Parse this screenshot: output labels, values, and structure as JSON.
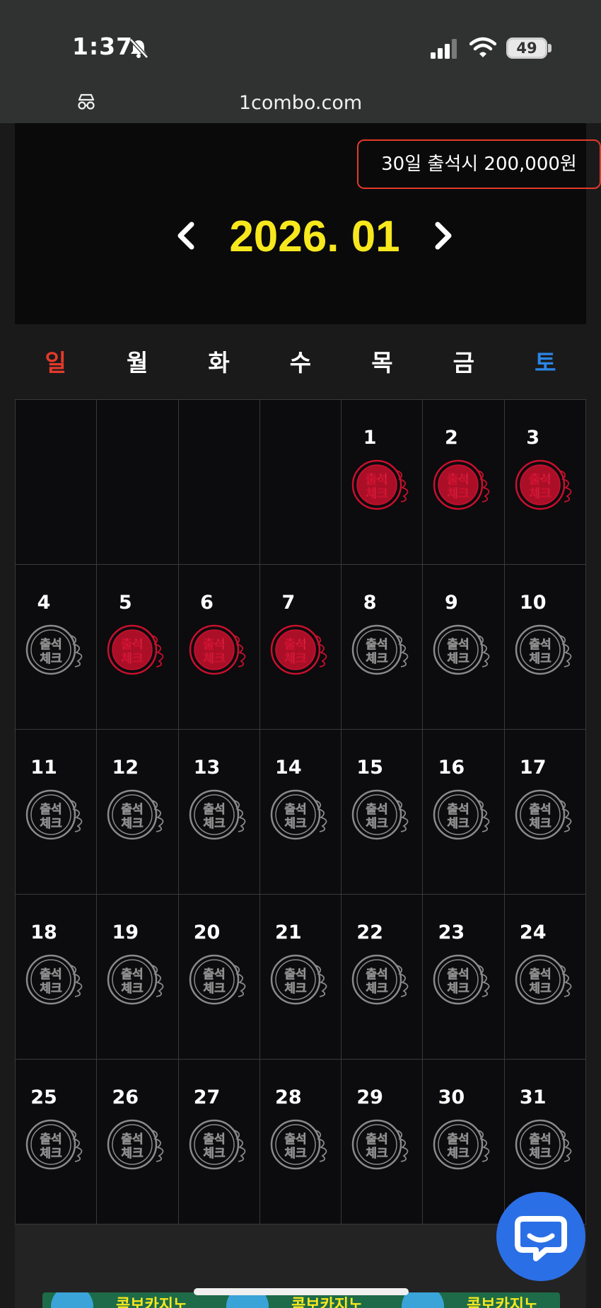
{
  "status_bar": {
    "time": "1:37",
    "battery": "49"
  },
  "browser": {
    "url": "1combo.com"
  },
  "attendance": {
    "reward_text": "30일 출석시 200,000원",
    "month_title": "2026. 01",
    "weekdays": [
      "일",
      "월",
      "화",
      "수",
      "목",
      "금",
      "토"
    ],
    "stamp_text": [
      "출석",
      "체크"
    ],
    "leading_blank_days": 4,
    "days": [
      {
        "day": "1",
        "checked": true
      },
      {
        "day": "2",
        "checked": true
      },
      {
        "day": "3",
        "checked": true
      },
      {
        "day": "4",
        "checked": false
      },
      {
        "day": "5",
        "checked": true
      },
      {
        "day": "6",
        "checked": true
      },
      {
        "day": "7",
        "checked": true
      },
      {
        "day": "8",
        "checked": false
      },
      {
        "day": "9",
        "checked": false
      },
      {
        "day": "10",
        "checked": false
      },
      {
        "day": "11",
        "checked": false
      },
      {
        "day": "12",
        "checked": false
      },
      {
        "day": "13",
        "checked": false
      },
      {
        "day": "14",
        "checked": false
      },
      {
        "day": "15",
        "checked": false
      },
      {
        "day": "16",
        "checked": false
      },
      {
        "day": "17",
        "checked": false
      },
      {
        "day": "18",
        "checked": false
      },
      {
        "day": "19",
        "checked": false
      },
      {
        "day": "20",
        "checked": false
      },
      {
        "day": "21",
        "checked": false
      },
      {
        "day": "22",
        "checked": false
      },
      {
        "day": "23",
        "checked": false
      },
      {
        "day": "24",
        "checked": false
      },
      {
        "day": "25",
        "checked": false
      },
      {
        "day": "26",
        "checked": false
      },
      {
        "day": "27",
        "checked": false
      },
      {
        "day": "28",
        "checked": false
      },
      {
        "day": "29",
        "checked": false
      },
      {
        "day": "30",
        "checked": false
      },
      {
        "day": "31",
        "checked": false
      }
    ]
  },
  "banners": [
    "콤보카지노",
    "콤보카지노",
    "콤보카지노"
  ],
  "colors": {
    "accent_yellow": "#f7e81e",
    "stamp_red": "#c8102e",
    "stamp_gray": "#8a8a8a",
    "sunday": "#e33a2a",
    "saturday": "#2a86e6",
    "chat_blue": "#2b6fe6"
  }
}
